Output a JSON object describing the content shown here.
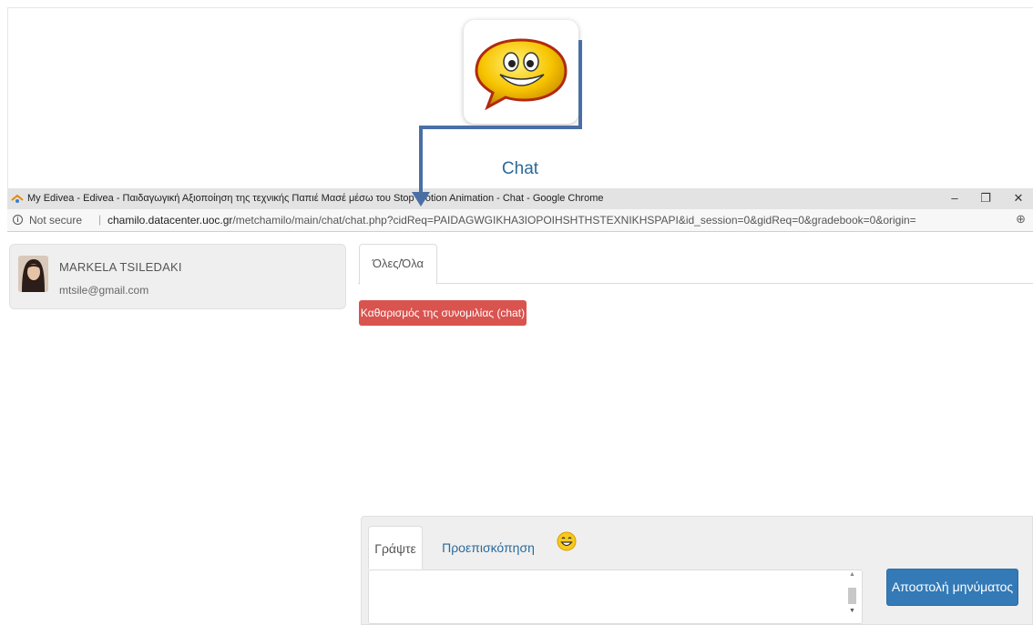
{
  "tool": {
    "label": "Chat",
    "icon": "chat-smiley-icon"
  },
  "browser": {
    "title": "My Edivea - Edivea - Παιδαγωγική Αξιοποίηση της τεχνικής Παπιέ Μασέ μέσω του Stop Motion Animation - Chat - Google Chrome",
    "security_label": "Not secure",
    "url_host": "chamilo.datacenter.uoc.gr",
    "url_path": "/metchamilo/main/chat/chat.php?cidReq=PAIDAGWGIKHA3IOPOIHSHTHSTEXNIKHSPAPI&id_session=0&gidReq=0&gradebook=0&origin=",
    "buttons": {
      "minimize": "–",
      "restore": "❐",
      "close": "✕"
    }
  },
  "user": {
    "name": "MARKELA TSILEDAKI",
    "email": "mtsile@gmail.com"
  },
  "chat": {
    "tab_all": "Όλες/Όλα",
    "clear_button": "Καθαρισμός της συνομιλίας (chat)",
    "write_tab": "Γράψτε",
    "preview_tab": "Προεπισκόπηση",
    "send_button": "Αποστολή μηνύματος",
    "message_value": ""
  },
  "colors": {
    "clear_button": "#d9534f",
    "send_button": "#337ab7",
    "link": "#2a6a9b",
    "arrow": "#4a6fa5"
  }
}
